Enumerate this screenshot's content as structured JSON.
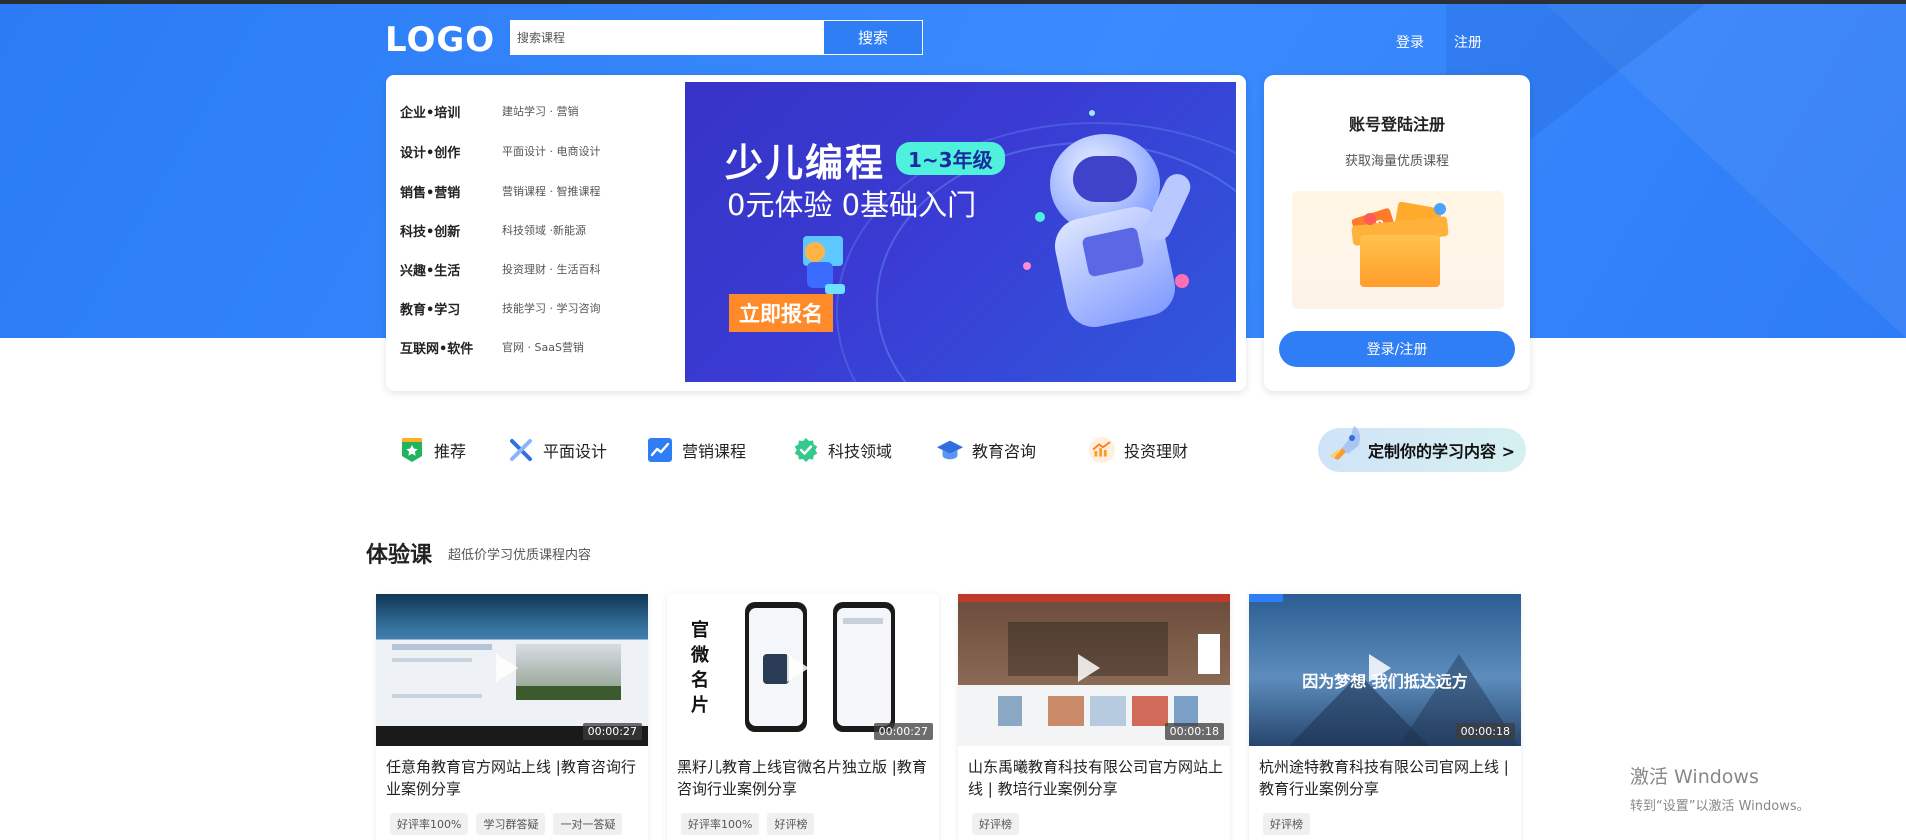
{
  "header": {
    "logo": "LOGO",
    "search_placeholder": "搜索课程",
    "search_button": "搜索",
    "login": "登录",
    "register": "注册"
  },
  "categories": [
    {
      "main": "企业•培训",
      "sub": "建站学习 · 营销"
    },
    {
      "main": "设计•创作",
      "sub": "平面设计 · 电商设计"
    },
    {
      "main": "销售•营销",
      "sub": "营销课程 · 智推课程"
    },
    {
      "main": "科技•创新",
      "sub": "科技领域 ·新能源"
    },
    {
      "main": "兴趣•生活",
      "sub": "投资理财 · 生活百科"
    },
    {
      "main": "教育•学习",
      "sub": "技能学习 · 学习咨询"
    },
    {
      "main": "互联网•软件",
      "sub": "官网 · SaaS营销"
    }
  ],
  "banner": {
    "title": "少儿编程",
    "badge": "1~3年级",
    "subtitle": "0元体验  0基础入门",
    "cta": "立即报名"
  },
  "login_card": {
    "title": "账号登陆注册",
    "subtitle": "获取海量优质课程",
    "button": "登录/注册",
    "ticket_vip": "VIP"
  },
  "quick_nav": [
    {
      "label": "推荐",
      "icon": "star-shield-icon",
      "color": "#22b35e"
    },
    {
      "label": "平面设计",
      "icon": "design-cross-icon",
      "color": "#2f6fe0"
    },
    {
      "label": "营销课程",
      "icon": "trend-chart-icon",
      "color": "#2f7ef6"
    },
    {
      "label": "科技领域",
      "icon": "check-badge-icon",
      "color": "#36c98c"
    },
    {
      "label": "教育咨询",
      "icon": "graduation-cap-icon",
      "color": "#2f6fe0"
    },
    {
      "label": "投资理财",
      "icon": "investment-chart-icon",
      "color": "#ff9a2a"
    }
  ],
  "customize": "定制你的学习内容 >",
  "section": {
    "title": "体验课",
    "subtitle": "超低价学习优质课程内容"
  },
  "courses": [
    {
      "title": "任意角教育官方网站上线 |教育咨询行业案例分享",
      "duration": "00:00:27",
      "tags": [
        "好评率100%",
        "学习群答疑",
        "一对一答疑"
      ]
    },
    {
      "title": "黑籽儿教育上线官微名片独立版 |教育咨询行业案例分享",
      "duration": "00:00:27",
      "tags": [
        "好评率100%",
        "好评榜"
      ],
      "thumb_text": "官微名片"
    },
    {
      "title": "山东禹曦教育科技有限公司官方网站上线 | 教培行业案例分享",
      "duration": "00:00:18",
      "tags": [
        "好评榜"
      ]
    },
    {
      "title": "杭州途特教育科技有限公司官网上线 | 教育行业案例分享",
      "duration": "00:00:18",
      "tags": [
        "好评榜"
      ],
      "thumb_text": "因为梦想 我们抵达远方"
    }
  ],
  "watermark": {
    "line1": "激活 Windows",
    "line2": "转到“设置”以激活 Windows。"
  }
}
